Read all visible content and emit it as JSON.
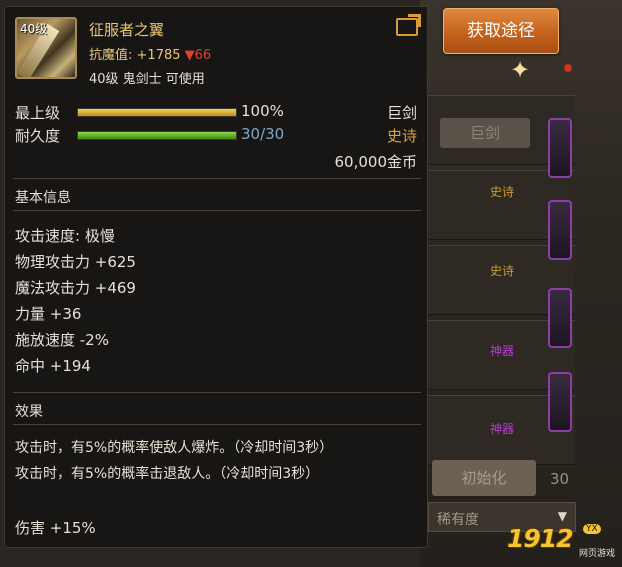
{
  "item": {
    "level_badge": "40级",
    "name": "征服者之翼",
    "resist_label": "抗魔值:",
    "resist_value": "+1785",
    "resist_drop": "▼66",
    "requirement": "40级 鬼剑士 可使用"
  },
  "stats": {
    "grade_label": "最上级",
    "grade_percent": "100%",
    "grade_fill": 1.0,
    "durability_label": "耐久度",
    "durability_value": "30/30",
    "durability_fill": 1.0,
    "weapon_type": "巨剑",
    "rarity": "史诗",
    "price": "60,000金币"
  },
  "basic_info": {
    "title": "基本信息",
    "lines": [
      "攻击速度: 极慢",
      "物理攻击力 +625",
      "魔法攻击力 +469",
      "力量 +36",
      "施放速度 -2%",
      "命中 +194"
    ]
  },
  "effects": {
    "title": "效果",
    "lines": [
      "攻击时，有5%的概率使敌人爆炸。（冷却时间3秒）",
      "攻击时，有5%的概率击退敌人。（冷却时间3秒）"
    ],
    "damage": "伤害 +15%"
  },
  "side": {
    "acquire_button": "获取途径",
    "category_button": "巨剑",
    "init_button": "初始化",
    "dropdown": "稀有度",
    "dropdown_arrow": "▼",
    "tags": [
      "史诗",
      "史诗",
      "神器",
      "神器"
    ],
    "partial_text": "30"
  },
  "watermark": {
    "number": "1912",
    "badge": "YX",
    "subtitle": "网页游戏"
  },
  "colors": {
    "gold_text": "#e8c872",
    "epic_orange": "#e0a23a",
    "down_red": "#e0412f",
    "durability_blue": "#7fa8c8"
  }
}
